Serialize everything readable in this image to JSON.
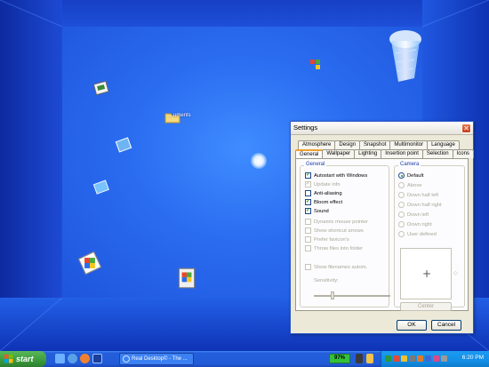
{
  "desktop": {
    "icon_label": "...uments",
    "icons": [
      "network-icon",
      "folder-icon",
      "windows-logo-icon",
      "control-panel-icon",
      "my-computer-icon",
      "internet-explorer-icon",
      "recycle-bin-icon"
    ]
  },
  "settings": {
    "title": "Settings",
    "close_glyph": "✕",
    "tabs_row1": [
      "Atmosphere",
      "Design",
      "Snapshot",
      "Multimonitor",
      "Language"
    ],
    "tabs_row2": [
      "General",
      "Wallpaper",
      "Lighting",
      "Insertion point",
      "Selection",
      "Icons"
    ],
    "active_tab": "General",
    "general": {
      "title": "General",
      "options": [
        {
          "label": "Autostart with Windows",
          "checked": true,
          "enabled": true
        },
        {
          "label": "Update info",
          "checked": true,
          "enabled": false
        },
        {
          "label": "Anti-aliasing",
          "checked": false,
          "enabled": true
        },
        {
          "label": "Bloom effect",
          "checked": true,
          "enabled": true
        },
        {
          "label": "Sound",
          "checked": true,
          "enabled": true
        },
        {
          "label": "Dynamic mouse pointer",
          "checked": false,
          "enabled": false
        },
        {
          "label": "Show shortcut arrows",
          "checked": false,
          "enabled": false
        },
        {
          "label": "Prefer favicon's",
          "checked": false,
          "enabled": false
        },
        {
          "label": "Throw files into folder",
          "checked": false,
          "enabled": false
        },
        {
          "label": "Show filenames autom.",
          "checked": false,
          "enabled": false
        }
      ],
      "sensitivity_label": "Sensitivity:"
    },
    "camera": {
      "title": "Camera",
      "options": [
        {
          "label": "Default",
          "selected": true,
          "enabled": true
        },
        {
          "label": "Above",
          "selected": false,
          "enabled": false
        },
        {
          "label": "Down half left",
          "selected": false,
          "enabled": false
        },
        {
          "label": "Down half right",
          "selected": false,
          "enabled": false
        },
        {
          "label": "Down left",
          "selected": false,
          "enabled": false
        },
        {
          "label": "Down right",
          "selected": false,
          "enabled": false
        },
        {
          "label": "User defined",
          "selected": false,
          "enabled": false
        }
      ],
      "preview_glyph": "+",
      "arrow_glyph": "◇",
      "center_label": "Center"
    },
    "ok_label": "OK",
    "cancel_label": "Cancel"
  },
  "taskbar": {
    "start_label": "start",
    "task_label": "Real Desktop© - The ...",
    "battery_label": "97%",
    "clock": "6:20 PM"
  },
  "colors": {
    "accent": "#245edb",
    "start_green": "#3a9a3c",
    "check_green": "#1f8a1f"
  }
}
